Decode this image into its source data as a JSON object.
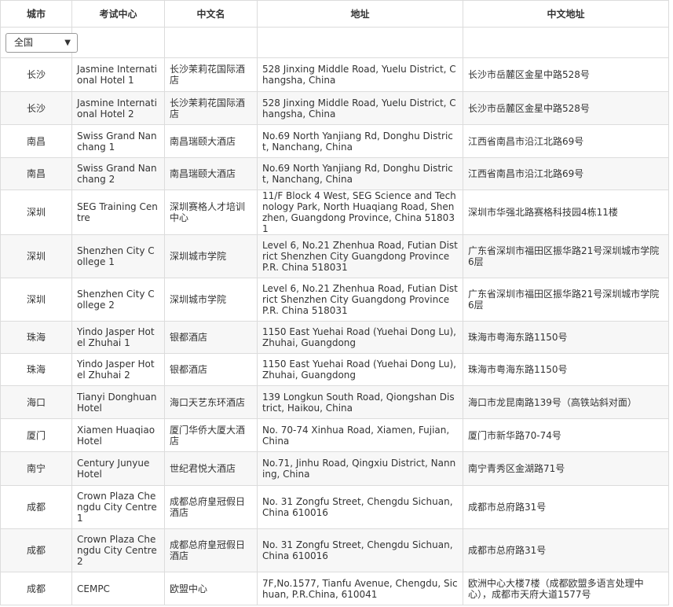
{
  "headers": {
    "city": "城市",
    "center": "考试中心",
    "cn_name": "中文名",
    "address": "地址",
    "cn_address": "中文地址"
  },
  "filter": {
    "selected": "全国",
    "caret": "▼"
  },
  "rows": [
    {
      "city": "长沙",
      "center": "Jasmine International Hotel 1",
      "cn_name": "长沙茉莉花国际酒店",
      "address": "528 Jinxing Middle Road, Yuelu District, Changsha, China",
      "cn_address": "长沙市岳麓区金星中路528号",
      "h": 43
    },
    {
      "city": "长沙",
      "center": "Jasmine International Hotel 2",
      "cn_name": "长沙茉莉花国际酒店",
      "address": "528 Jinxing Middle Road, Yuelu District, Changsha, China",
      "cn_address": "长沙市岳麓区金星中路528号",
      "h": 42
    },
    {
      "city": "南昌",
      "center": "Swiss Grand Nanchang 1",
      "cn_name": "南昌瑞颐大酒店",
      "address": "No.69 North Yanjiang Rd, Donghu District, Nanchang, China",
      "cn_address": "江西省南昌市沿江北路69号",
      "h": 42
    },
    {
      "city": "南昌",
      "center": "Swiss Grand Nanchang 2",
      "cn_name": "南昌瑞颐大酒店",
      "address": "No.69 North Yanjiang Rd, Donghu District, Nanchang, China",
      "cn_address": "江西省南昌市沿江北路69号",
      "h": 41
    },
    {
      "city": "深圳",
      "center": "SEG Training Centre",
      "cn_name": "深圳赛格人才培训中心",
      "address": "11/F Block 4 West, SEG Science and Technology Park, North Huaqiang Road, Shenzhen, Guangdong Province, China 518031",
      "cn_address": "深圳市华强北路赛格科技园4栋11楼",
      "h": 55
    },
    {
      "city": "深圳",
      "center": "Shenzhen City College 1",
      "cn_name": "深圳城市学院",
      "address": "Level 6, No.21 Zhenhua Road, Futian District Shenzhen City Guangdong Province P.R. China 518031",
      "cn_address": "广东省深圳市福田区振华路21号深圳城市学院6层",
      "h": 55
    },
    {
      "city": "深圳",
      "center": "Shenzhen City College 2",
      "cn_name": "深圳城市学院",
      "address": "Level 6, No.21 Zhenhua Road, Futian District Shenzhen City Guangdong Province P.R. China 518031",
      "cn_address": "广东省深圳市福田区振华路21号深圳城市学院6层",
      "h": 55
    },
    {
      "city": "珠海",
      "center": "Yindo Jasper Hotel Zhuhai 1",
      "cn_name": "银都酒店",
      "address": "1150 East Yuehai Road (Yuehai Dong Lu), Zhuhai, Guangdong",
      "cn_address": "珠海市粤海东路1150号",
      "h": 41
    },
    {
      "city": "珠海",
      "center": "Yindo Jasper Hotel Zhuhai 2",
      "cn_name": "银都酒店",
      "address": "1150 East Yuehai Road (Yuehai Dong Lu), Zhuhai, Guangdong",
      "cn_address": "珠海市粤海东路1150号",
      "h": 41
    },
    {
      "city": "海口",
      "center": "Tianyi Donghuan Hotel",
      "cn_name": "海口天艺东环酒店",
      "address": "139 Longkun South Road, Qiongshan District, Haikou, China",
      "cn_address": "海口市龙昆南路139号（高铁站斜对面）",
      "h": 42
    },
    {
      "city": "厦门",
      "center": "Xiamen Huaqiao Hotel",
      "cn_name": "厦门华侨大厦大酒店",
      "address": "No. 70-74 Xinhua Road, Xiamen, Fujian, China",
      "cn_address": "厦门市新华路70-74号",
      "h": 42
    },
    {
      "city": "南宁",
      "center": "Century Junyue Hotel",
      "cn_name": "世纪君悦大酒店",
      "address": "No.71, Jinhu Road, Qingxiu District, Nanning, China",
      "cn_address": "南宁青秀区金湖路71号",
      "h": 43
    },
    {
      "city": "成都",
      "center": "Crown Plaza Chengdu City Centre 1",
      "cn_name": "成都总府皇冠假日酒店",
      "address": "No. 31 Zongfu Street, Chengdu Sichuan, China 610016",
      "cn_address": "成都市总府路31号",
      "h": 55
    },
    {
      "city": "成都",
      "center": "Crown Plaza Chengdu City Centre 2",
      "cn_name": "成都总府皇冠假日酒店",
      "address": "No. 31 Zongfu Street, Chengdu Sichuan, China 610016",
      "cn_address": "成都市总府路31号",
      "h": 55
    },
    {
      "city": "成都",
      "center": "CEMPC",
      "cn_name": "欧盟中心",
      "address": "7F,No.1577, Tianfu Avenue, Chengdu, Sichuan, P.R.China, 610041",
      "cn_address": "欧洲中心大楼7楼（成都欧盟多语言处理中心），成都市天府大道1577号",
      "h": 42
    }
  ]
}
